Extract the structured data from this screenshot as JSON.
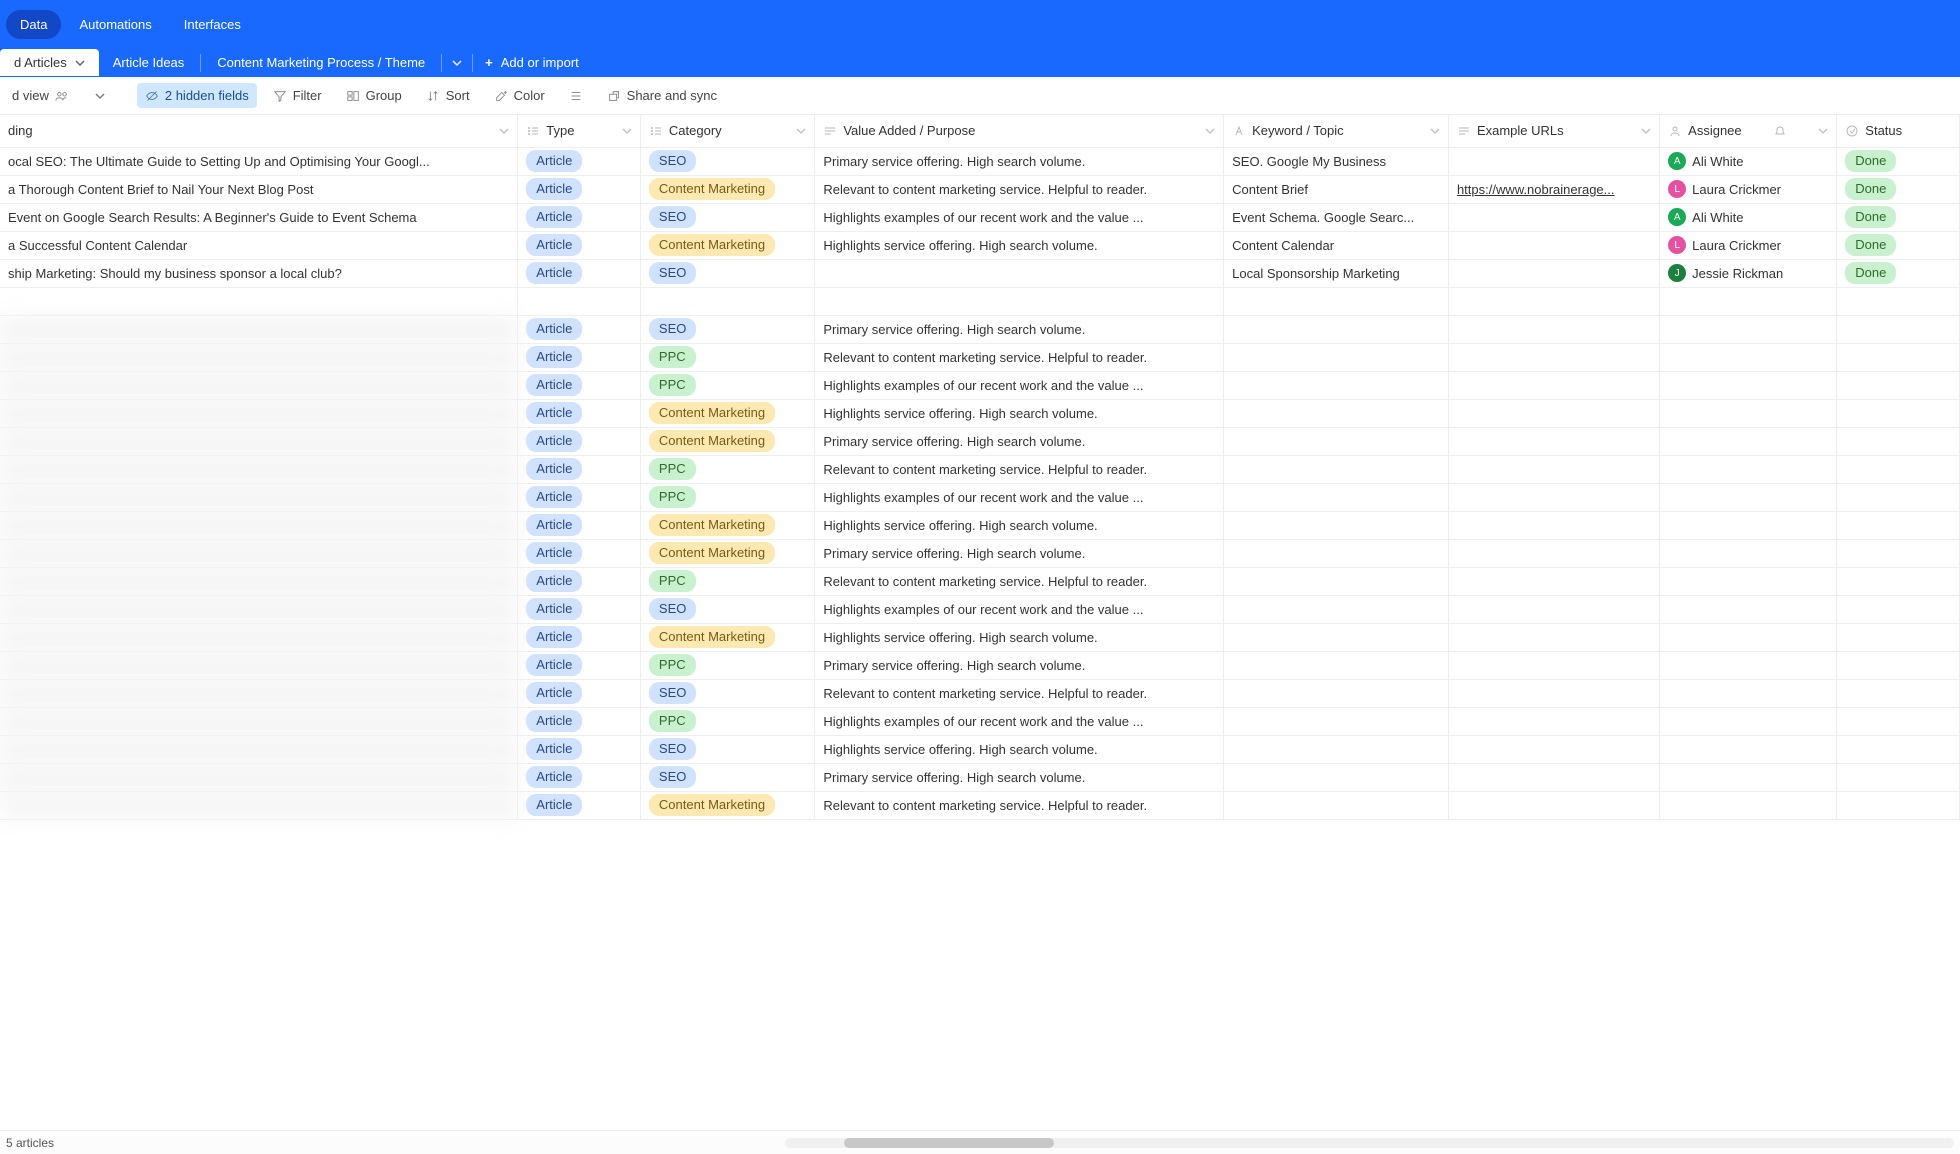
{
  "topnav": {
    "items": [
      "Data",
      "Automations",
      "Interfaces"
    ],
    "activeIndex": 0
  },
  "tabs": {
    "items": [
      {
        "label": "d Articles",
        "active": true,
        "hasDropdown": true
      },
      {
        "label": "Article Ideas"
      },
      {
        "label": "Content Marketing Process / Theme"
      }
    ],
    "add_label": "Add or import"
  },
  "toolbar": {
    "view_label": "d view",
    "hidden_fields_label": "2 hidden fields",
    "filter_label": "Filter",
    "group_label": "Group",
    "sort_label": "Sort",
    "color_label": "Color",
    "rowheight_label": "",
    "share_label": "Share and sync"
  },
  "columns": {
    "heading": "ding",
    "type": "Type",
    "category": "Category",
    "value": "Value Added / Purpose",
    "keyword": "Keyword / Topic",
    "urls": "Example URLs",
    "assignee": "Assignee",
    "status": "Status"
  },
  "rows": [
    {
      "heading": "ocal SEO: The Ultimate Guide to Setting Up and Optimising Your Googl...",
      "type": "Article",
      "category": "SEO",
      "value": "Primary service offering. High search volume.",
      "keyword": "SEO. Google My Business",
      "url": "",
      "assignee": {
        "initial": "A",
        "name": "Ali White",
        "color": "green"
      },
      "status": "Done"
    },
    {
      "heading": "a Thorough Content Brief to Nail Your Next Blog Post",
      "type": "Article",
      "category": "Content Marketing",
      "value": "Relevant to content marketing service. Helpful to reader.",
      "keyword": "Content Brief",
      "url": "https://www.nobrainerage...",
      "assignee": {
        "initial": "L",
        "name": "Laura Crickmer",
        "color": "pink"
      },
      "status": "Done"
    },
    {
      "heading": " Event on Google Search Results: A Beginner's Guide to Event Schema",
      "type": "Article",
      "category": "SEO",
      "value": "Highlights examples of our recent work and the value ...",
      "keyword": "Event Schema. Google Searc...",
      "url": "",
      "assignee": {
        "initial": "A",
        "name": "Ali White",
        "color": "green"
      },
      "status": "Done"
    },
    {
      "heading": " a Successful Content Calendar",
      "type": "Article",
      "category": "Content Marketing",
      "value": "Highlights service offering. High search volume.",
      "keyword": "Content Calendar",
      "url": "",
      "assignee": {
        "initial": "L",
        "name": "Laura Crickmer",
        "color": "pink"
      },
      "status": "Done"
    },
    {
      "heading": "ship Marketing: Should my business sponsor a local club?",
      "type": "Article",
      "category": "SEO",
      "value": "",
      "keyword": "Local Sponsorship Marketing",
      "url": "",
      "assignee": {
        "initial": "J",
        "name": "Jessie Rickman",
        "color": "dgreen"
      },
      "status": "Done"
    },
    {
      "gap": true
    },
    {
      "blur": true,
      "type": "Article",
      "category": "SEO",
      "value": "Primary service offering. High search volume."
    },
    {
      "blur": true,
      "type": "Article",
      "category": "PPC",
      "value": "Relevant to content marketing service. Helpful to reader."
    },
    {
      "blur": true,
      "type": "Article",
      "category": "PPC",
      "value": "Highlights examples of our recent work and the value ..."
    },
    {
      "blur": true,
      "type": "Article",
      "category": "Content Marketing",
      "value": "Highlights service offering. High search volume."
    },
    {
      "blur": true,
      "type": "Article",
      "category": "Content Marketing",
      "value": "Primary service offering. High search volume."
    },
    {
      "blur": true,
      "type": "Article",
      "category": "PPC",
      "value": "Relevant to content marketing service. Helpful to reader."
    },
    {
      "blur": true,
      "type": "Article",
      "category": "PPC",
      "value": "Highlights examples of our recent work and the value ..."
    },
    {
      "blur": true,
      "type": "Article",
      "category": "Content Marketing",
      "value": "Highlights service offering. High search volume."
    },
    {
      "blur": true,
      "type": "Article",
      "category": "Content Marketing",
      "value": "Primary service offering. High search volume."
    },
    {
      "blur": true,
      "type": "Article",
      "category": "PPC",
      "value": "Relevant to content marketing service. Helpful to reader."
    },
    {
      "blur": true,
      "type": "Article",
      "category": "SEO",
      "value": "Highlights examples of our recent work and the value ..."
    },
    {
      "blur": true,
      "type": "Article",
      "category": "Content Marketing",
      "value": "Highlights service offering. High search volume."
    },
    {
      "blur": true,
      "type": "Article",
      "category": "PPC",
      "value": "Primary service offering. High search volume."
    },
    {
      "blur": true,
      "type": "Article",
      "category": "SEO",
      "value": "Relevant to content marketing service. Helpful to reader."
    },
    {
      "blur": true,
      "type": "Article",
      "category": "PPC",
      "value": "Highlights examples of our recent work and the value ..."
    },
    {
      "blur": true,
      "type": "Article",
      "category": "SEO",
      "value": "Highlights service offering. High search volume."
    },
    {
      "blur": true,
      "type": "Article",
      "category": "SEO",
      "value": "Primary service offering. High search volume."
    },
    {
      "blur": true,
      "type": "Article",
      "category": "Content Marketing",
      "value": "Relevant to content marketing service. Helpful to reader."
    }
  ],
  "status_text": "5 articles"
}
